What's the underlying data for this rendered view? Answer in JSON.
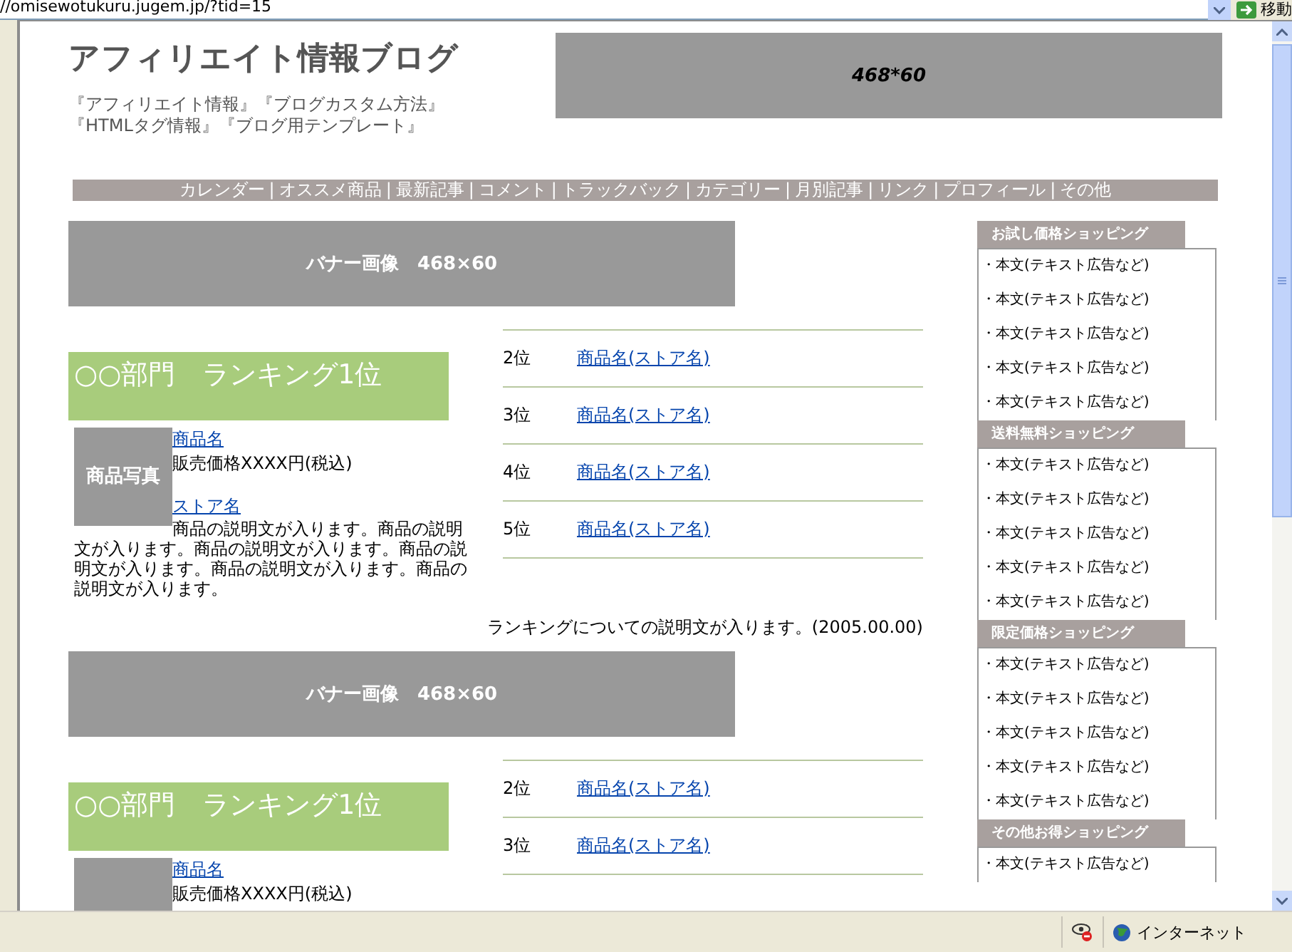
{
  "address_bar": {
    "url": "//omisewotukuru.jugem.jp/?tid=15",
    "go_label": "移動"
  },
  "header": {
    "title": "アフィリエイト情報ブログ",
    "tagline_lines": [
      "『アフィリエイト情報』『ブログカスタム方法』",
      "『HTMLタグ情報』『ブログ用テンプレート』"
    ],
    "ad_banner": "468*60"
  },
  "nav": {
    "separator": "|",
    "items": [
      "カレンダー",
      "オススメ商品",
      "最新記事",
      "コメント",
      "トラックバック",
      "カテゴリー",
      "月別記事",
      "リンク",
      "プロフィール",
      "その他"
    ]
  },
  "sections": [
    {
      "banner": "バナー画像　468×60",
      "category_title": "○○部門　ランキング1位",
      "product": {
        "photo_label": "商品写真",
        "name": "商品名",
        "price": "販売価格XXXX円(税込)",
        "store": "ストア名",
        "description": "商品の説明文が入ります。商品の説明文が入ります。商品の説明文が入ります。商品の説明文が入ります。商品の説明文が入ります。商品の説明文が入ります。"
      },
      "ranks": [
        {
          "rank": "2位",
          "link": "商品名(ストア名)"
        },
        {
          "rank": "3位",
          "link": "商品名(ストア名)"
        },
        {
          "rank": "4位",
          "link": "商品名(ストア名)"
        },
        {
          "rank": "5位",
          "link": "商品名(ストア名)"
        }
      ],
      "footnote": "ランキングについての説明文が入ります。(2005.00.00)"
    },
    {
      "banner": "バナー画像　468×60",
      "category_title": "○○部門　ランキング1位",
      "product": {
        "name": "商品名",
        "price": "販売価格XXXX円(税込)"
      },
      "ranks": [
        {
          "rank": "2位",
          "link": "商品名(ストア名)"
        },
        {
          "rank": "3位",
          "link": "商品名(ストア名)"
        }
      ]
    }
  ],
  "sidebar": [
    {
      "title": "お試し価格ショッピング",
      "items": [
        "・本文(テキスト広告など)",
        "・本文(テキスト広告など)",
        "・本文(テキスト広告など)",
        "・本文(テキスト広告など)",
        "・本文(テキスト広告など)"
      ]
    },
    {
      "title": "送料無料ショッピング",
      "items": [
        "・本文(テキスト広告など)",
        "・本文(テキスト広告など)",
        "・本文(テキスト広告など)",
        "・本文(テキスト広告など)",
        "・本文(テキスト広告など)"
      ]
    },
    {
      "title": "限定価格ショッピング",
      "items": [
        "・本文(テキスト広告など)",
        "・本文(テキスト広告など)",
        "・本文(テキスト広告など)",
        "・本文(テキスト広告など)",
        "・本文(テキスト広告など)"
      ]
    },
    {
      "title": "その他お得ショッピング",
      "items": [
        "・本文(テキスト広告など)"
      ]
    }
  ],
  "status_bar": {
    "zone": "インターネット"
  }
}
